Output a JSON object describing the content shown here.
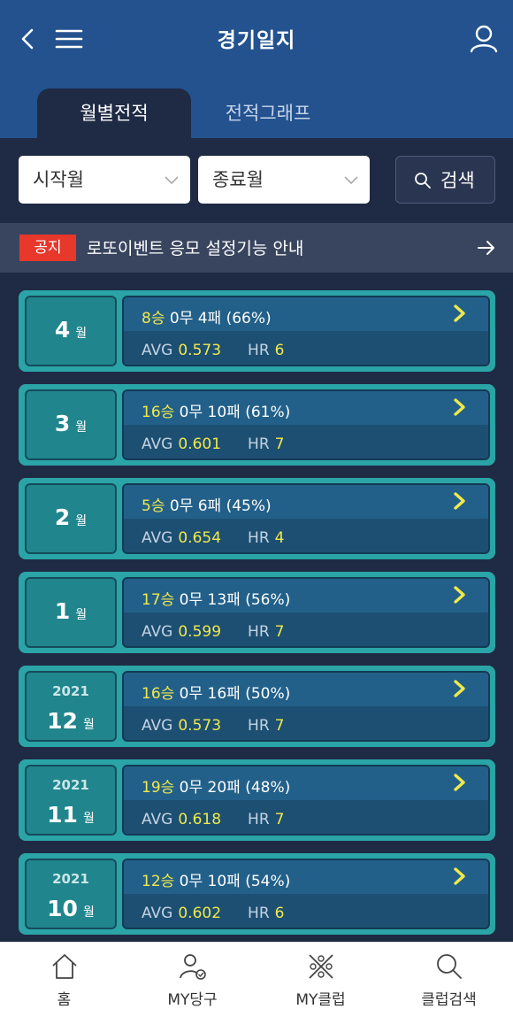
{
  "header": {
    "title": "경기일지",
    "back_icon": "chevron-left-icon",
    "menu_icon": "hamburger-menu-icon",
    "profile_icon": "user-icon"
  },
  "tabs": [
    {
      "label": "월별전적",
      "active": true
    },
    {
      "label": "전적그래프",
      "active": false
    }
  ],
  "filters": {
    "start_placeholder": "시작월",
    "end_placeholder": "종료월",
    "search_label": "검색"
  },
  "notice": {
    "tag": "공지",
    "text": "로또이벤트 응모 설정기능 안내"
  },
  "records": [
    {
      "year": "",
      "month": "4",
      "month_unit": "월",
      "wins": "8승",
      "rest": " 0무 4패 (66%)",
      "avg_label": "AVG",
      "avg": "0.573",
      "hr_label": "HR",
      "hr": "6"
    },
    {
      "year": "",
      "month": "3",
      "month_unit": "월",
      "wins": "16승",
      "rest": " 0무 10패 (61%)",
      "avg_label": "AVG",
      "avg": "0.601",
      "hr_label": "HR",
      "hr": "7"
    },
    {
      "year": "",
      "month": "2",
      "month_unit": "월",
      "wins": "5승",
      "rest": " 0무 6패 (45%)",
      "avg_label": "AVG",
      "avg": "0.654",
      "hr_label": "HR",
      "hr": "4"
    },
    {
      "year": "",
      "month": "1",
      "month_unit": "월",
      "wins": "17승",
      "rest": " 0무 13패 (56%)",
      "avg_label": "AVG",
      "avg": "0.599",
      "hr_label": "HR",
      "hr": "7"
    },
    {
      "year": "2021",
      "month": "12",
      "month_unit": "월",
      "wins": "16승",
      "rest": " 0무 16패 (50%)",
      "avg_label": "AVG",
      "avg": "0.573",
      "hr_label": "HR",
      "hr": "7"
    },
    {
      "year": "2021",
      "month": "11",
      "month_unit": "월",
      "wins": "19승",
      "rest": " 0무 20패 (48%)",
      "avg_label": "AVG",
      "avg": "0.618",
      "hr_label": "HR",
      "hr": "7"
    },
    {
      "year": "2021",
      "month": "10",
      "month_unit": "월",
      "wins": "12승",
      "rest": " 0무 10패 (54%)",
      "avg_label": "AVG",
      "avg": "0.602",
      "hr_label": "HR",
      "hr": "6"
    }
  ],
  "navbar": [
    {
      "label": "홈",
      "icon": "home-icon"
    },
    {
      "label": "MY당구",
      "icon": "my-billiards-icon"
    },
    {
      "label": "MY클럽",
      "icon": "my-club-icon"
    },
    {
      "label": "클럽검색",
      "icon": "search-icon"
    }
  ],
  "colors": {
    "header": "#23528f",
    "background": "#1f2a44",
    "card": "#2aa4a6",
    "highlight": "#f1e94a",
    "notice_tag": "#e8372b"
  }
}
